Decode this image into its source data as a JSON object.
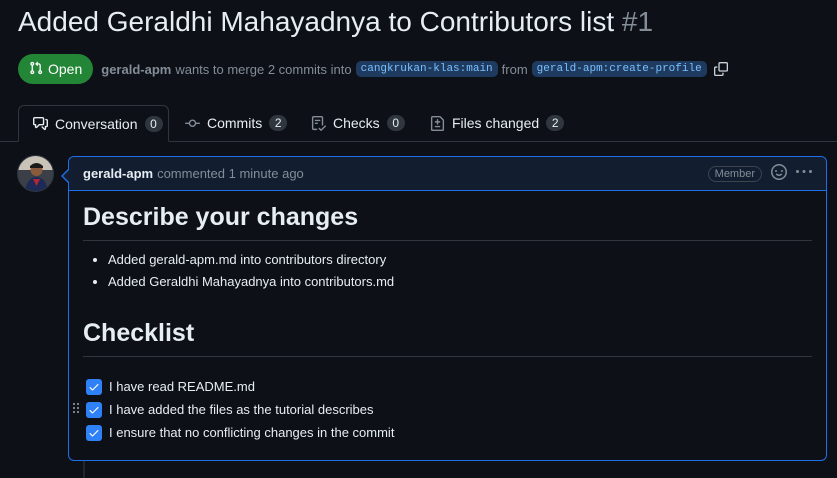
{
  "pr": {
    "title": "Added Geraldhi Mahayadnya to Contributors list",
    "number": "#1",
    "state": "Open",
    "author": "gerald-apm",
    "merge_text": "wants to merge 2 commits into",
    "base_branch": "cangkrukan-klas:main",
    "from_text": "from",
    "head_branch": "gerald-apm:create-profile"
  },
  "tabs": [
    {
      "label": "Conversation",
      "count": "0"
    },
    {
      "label": "Commits",
      "count": "2"
    },
    {
      "label": "Checks",
      "count": "0"
    },
    {
      "label": "Files changed",
      "count": "2"
    }
  ],
  "comment": {
    "author": "gerald-apm",
    "timestamp": "commented 1 minute ago",
    "role": "Member",
    "heading1": "Describe your changes",
    "changes": [
      "Added gerald-apm.md into contributors directory",
      "Added Geraldhi Mahayadnya into contributors.md"
    ],
    "heading2": "Checklist",
    "checklist": [
      "I have read README.md",
      "I have added the files as the tutorial describes",
      "I ensure that no conflicting changes in the commit"
    ]
  },
  "colors": {
    "background": "#0d1117",
    "open_green": "#238636",
    "accent_blue": "#1f6feb",
    "checkbox_blue": "#2f81f7"
  },
  "icons": {
    "state": "git-pull-request-icon",
    "copy": "copy-icon",
    "tabs": [
      "comment-discussion-icon",
      "git-commit-icon",
      "checklist-icon",
      "file-diff-icon"
    ],
    "emoji": "smiley-icon",
    "menu": "kebab-horizontal-icon"
  }
}
